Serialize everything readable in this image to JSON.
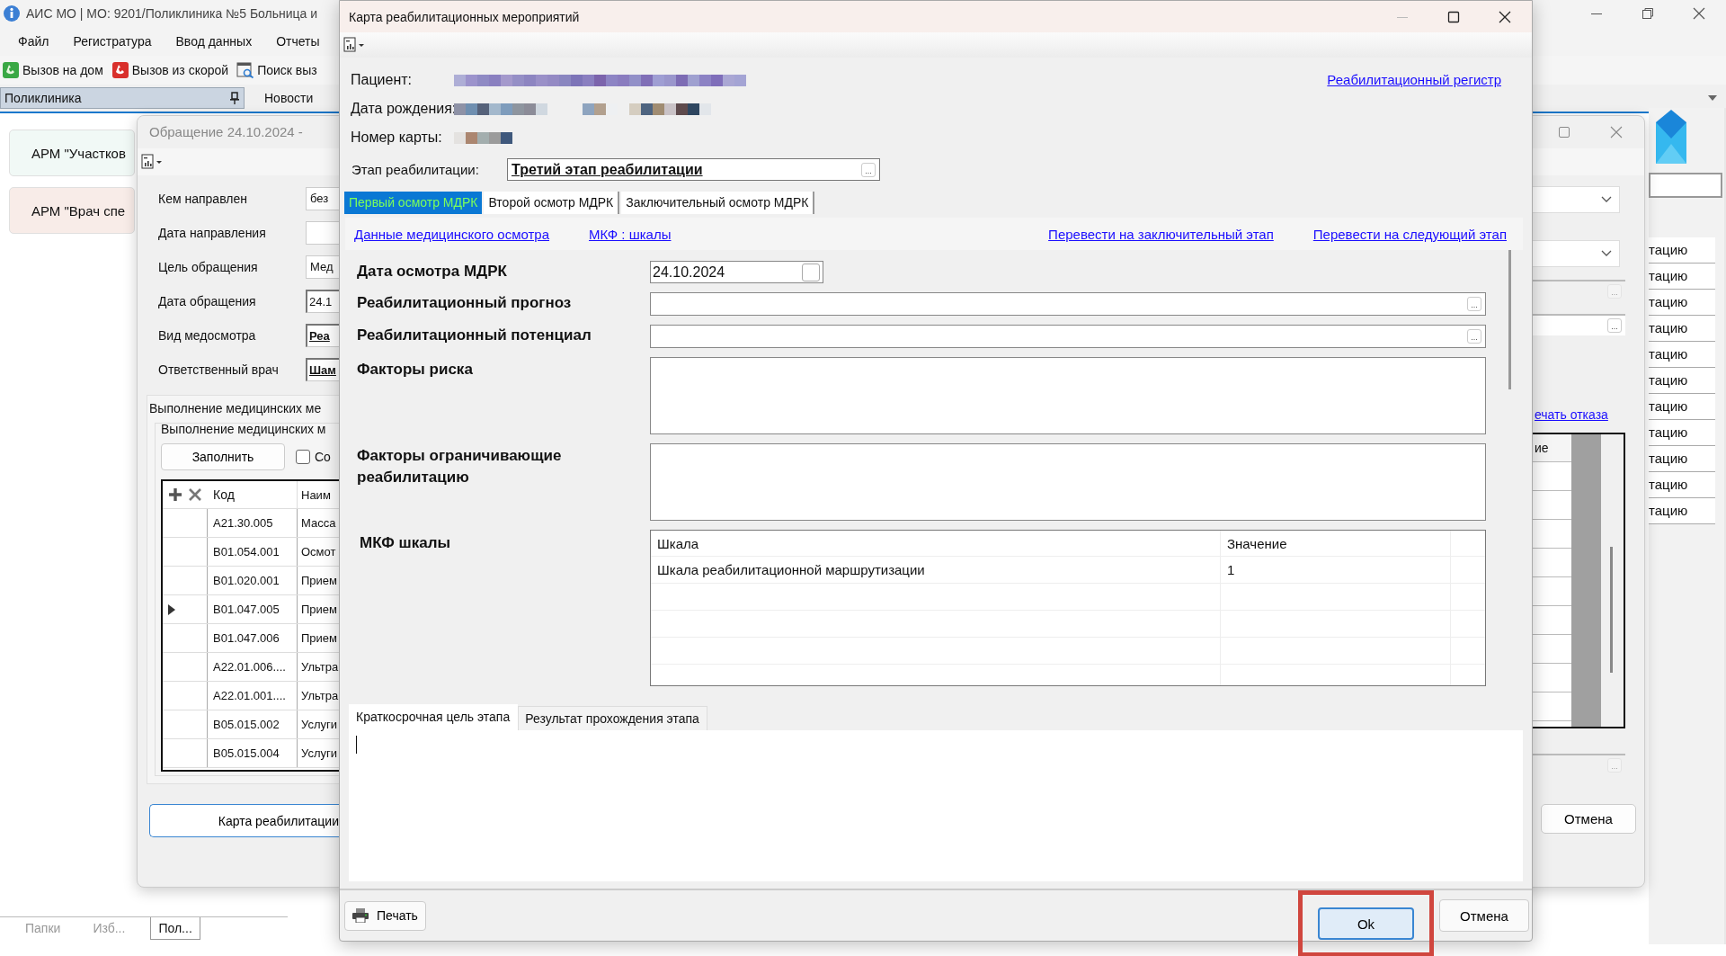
{
  "main_window": {
    "title": "АИС МО | МО: 9201/Поликлиника №5 Больница и",
    "menu": [
      "Файл",
      "Регистратура",
      "Ввод данных",
      "Отчеты"
    ],
    "toolbar": [
      {
        "label": "Вызов на дом",
        "kind": "home-call"
      },
      {
        "label": "Вызов из скорой",
        "kind": "ambulance-call"
      },
      {
        "label": "Поиск выз",
        "kind": "search-call"
      }
    ],
    "panel_title": "Поликлиника",
    "news_tab": "Новости",
    "cards": [
      {
        "label": "АРМ \"Участков",
        "color": "#f1f9f6"
      },
      {
        "label": "АРМ \"Врач спе",
        "color": "#f8ece8"
      }
    ],
    "bottom_tabs": [
      {
        "label": "Папки",
        "selected": false
      },
      {
        "label": "Изб...",
        "selected": false
      },
      {
        "label": "Пол...",
        "selected": true
      }
    ]
  },
  "appeal_window": {
    "title": "Обращение 24.10.2024 -",
    "fields": [
      {
        "label": "Кем направлен",
        "value": "без",
        "kind": "plain"
      },
      {
        "label": "Дата направления",
        "kind": "plain"
      },
      {
        "label": "Цель обращения",
        "value": "Мед",
        "kind": "plain"
      },
      {
        "label": "Дата обращения",
        "value": "24.1",
        "kind": "date"
      },
      {
        "label": "Вид медосмотра",
        "value": "Реа",
        "kind": "bold"
      },
      {
        "label": "Ответственный врач",
        "value": "Шам",
        "kind": "bold"
      }
    ],
    "group_title": "Выполнение медицинских ме",
    "subgroup_title": "Выполнение медицинских м",
    "fill_button": "Заполнить",
    "checkbox": {
      "label": "Со",
      "checked": false
    },
    "grid": {
      "columns": [
        "Код",
        "Наим"
      ],
      "rows": [
        {
          "code": "A21.30.005",
          "name": "Масса",
          "current": false
        },
        {
          "code": "B01.054.001",
          "name": "Осмот",
          "current": false
        },
        {
          "code": "B01.020.001",
          "name": "Прием",
          "current": false
        },
        {
          "code": "B01.047.005",
          "name": "Прием",
          "current": true
        },
        {
          "code": "B01.047.006",
          "name": "Прием",
          "current": false
        },
        {
          "code": "A22.01.006....",
          "name": "Ультра",
          "current": false
        },
        {
          "code": "A22.01.001....",
          "name": "Ультра",
          "current": false
        },
        {
          "code": "B05.015.002",
          "name": "Услуги",
          "current": false
        },
        {
          "code": "B05.015.004",
          "name": "Услуги",
          "current": false
        }
      ]
    },
    "rehab_button": "Карта реабилитации",
    "right_fields": [
      {
        "button": "...",
        "disabled": true
      },
      {
        "button": "...",
        "disabled": false
      },
      {
        "button": "...",
        "disabled": true
      }
    ],
    "refusal_link": "ечать отказа",
    "right_grid_column": "ие",
    "cancel_button": "Отмена"
  },
  "side_list": [
    "тацию",
    "тацию",
    "тацию",
    "тацию",
    "тацию",
    "тацию",
    "тацию",
    "тацию",
    "тацию",
    "тацию",
    "тацию"
  ],
  "dialog": {
    "title": "Карта реабилитационных мероприятий",
    "patient_labels": [
      "Пациент:",
      "Дата рождения:",
      "Номер карты:"
    ],
    "register_link": "Реабилитационный регистр",
    "stage": {
      "label": "Этап реабилитации:",
      "value": "Третий этап реабилитации",
      "button": "..."
    },
    "tabs": [
      {
        "label": "Первый осмотр МДРК",
        "selected": true
      },
      {
        "label": "Второй осмотр МДРК",
        "selected": false
      },
      {
        "label": "Заключительный осмотр МДРК",
        "selected": false
      }
    ],
    "links_left": [
      "Данные медицинского осмотра",
      "МКФ : шкалы"
    ],
    "links_right": [
      "Перевести на заключительный этап",
      "Перевести на следующий этап"
    ],
    "form": [
      {
        "label": "Дата осмотра МДРК",
        "kind": "date",
        "value": "24.10.2024"
      },
      {
        "label": "Реабилитационный прогноз",
        "kind": "picker",
        "button": "..."
      },
      {
        "label": "Реабилитационный потенциал",
        "kind": "picker",
        "button": "..."
      },
      {
        "label": "Факторы риска",
        "kind": "text"
      },
      {
        "label": "Факторы ограничивающие реабилитацию",
        "kind": "text"
      }
    ],
    "icf": {
      "label": "МКФ шкалы",
      "columns": [
        "Шкала",
        "Значение"
      ],
      "rows": [
        {
          "scale": "Шкала реабилитационной маршрутизации",
          "value": "1"
        }
      ]
    },
    "bottom_tabs": [
      {
        "label": "Краткосрочная цель этапа",
        "selected": true
      },
      {
        "label": "Результат прохождения этапа",
        "selected": false
      }
    ],
    "print_button": "Печать",
    "ok_button": {
      "label": "Ok",
      "focused": true,
      "marked": true
    },
    "cancel_button": "Отмена"
  }
}
